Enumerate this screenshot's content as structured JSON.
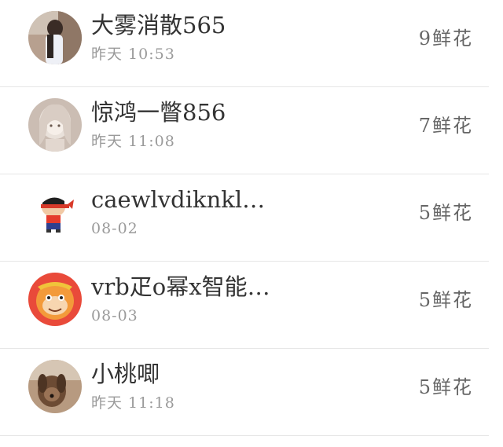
{
  "list": {
    "items": [
      {
        "name": "大雾消散565",
        "time": "昨天 10:53",
        "flowers": "9鲜花",
        "avatar": "avatar-girl-photo"
      },
      {
        "name": "惊鸿一瞥856",
        "time": "昨天 11:08",
        "flowers": "7鲜花",
        "avatar": "avatar-anime-girl"
      },
      {
        "name": "caewlvdiknklein",
        "time": "08-02",
        "flowers": "5鲜花",
        "avatar": "avatar-cartoon-boy"
      },
      {
        "name": "vrb疋o幂x智能…",
        "time": "08-03",
        "flowers": "5鲜花",
        "avatar": "avatar-monkey-cartoon"
      },
      {
        "name": "小桃唧",
        "time": "昨天 11:18",
        "flowers": "5鲜花",
        "avatar": "avatar-dog-photo"
      }
    ]
  }
}
